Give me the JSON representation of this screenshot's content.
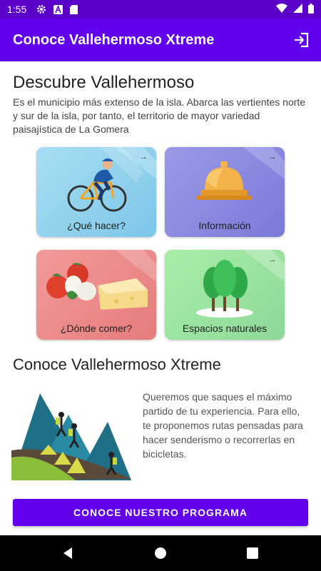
{
  "status_bar": {
    "time": "1:55",
    "icons": [
      "gear-icon",
      "font-a-icon",
      "sd-card-icon",
      "wifi-icon",
      "signal-icon",
      "battery-icon"
    ]
  },
  "app_bar": {
    "title": "Conoce Vallehermoso Xtreme",
    "action_icon": "exit-to-app-icon"
  },
  "intro": {
    "title": "Descubre Vallehermoso",
    "description": "Es el municipio más extenso de la isla. Abarca las vertientes norte y sur de la isla, por tanto, el territorio de mayor variedad paisajística de La Gomera"
  },
  "cards": [
    {
      "label": "¿Qué hacer?",
      "arrow": "→",
      "icon": "cyclist-icon",
      "color": "#8fd0ec"
    },
    {
      "label": "Información",
      "arrow": "→",
      "icon": "reception-bell-icon",
      "color": "#8a8ae0"
    },
    {
      "label": "¿Dónde comer?",
      "arrow": "→",
      "icon": "cheese-tomato-icon",
      "color": "#ee8a8a"
    },
    {
      "label": "Espacios naturales",
      "arrow": "→",
      "icon": "trees-icon",
      "color": "#9ee8a4"
    }
  ],
  "promo": {
    "title": "Conoce Vallehermoso Xtreme",
    "text": "Queremos que saques el máximo partido de tu experiencia. Para ello, te proponemos rutas pensadas para hacer senderismo o recorrerlas en bicicletas.",
    "illustration": "hikers-mountain-illustration"
  },
  "cta": {
    "label": "CONOCE NUESTRO PROGRAMA"
  },
  "nav": [
    "back-icon",
    "home-icon",
    "recents-icon"
  ],
  "colors": {
    "primary": "#6200ee",
    "status_bar": "#5a00c8"
  }
}
